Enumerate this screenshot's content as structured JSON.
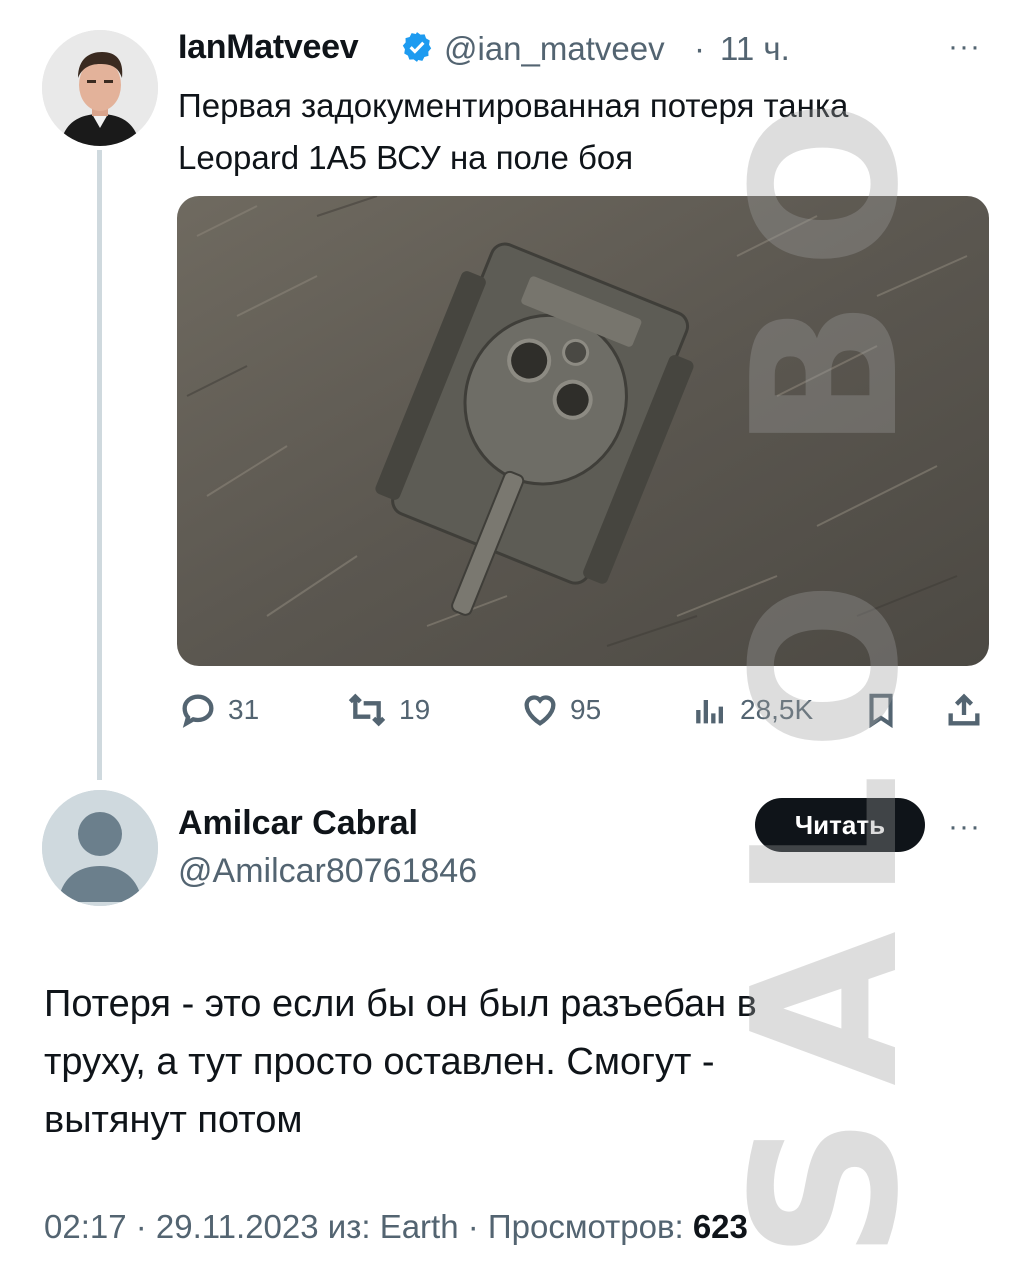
{
  "tweet": {
    "author_name": "IanMatveev",
    "author_handle": "@ian_matveev",
    "separator": "·",
    "time": "11 ч.",
    "more": "···",
    "text": "Первая задокументированная потеря танка\nLeopard 1A5 ВСУ на поле боя",
    "image_alt": "Tank on field",
    "actions": {
      "replies": "31",
      "retweets": "19",
      "likes": "95",
      "views": "28,5K"
    },
    "icons": [
      "verified-icon",
      "reply-icon",
      "retweet-icon",
      "like-icon",
      "views-icon",
      "bookmark-icon",
      "share-icon"
    ]
  },
  "reply": {
    "author_name": "Amilcar Cabral",
    "author_handle": "@Amilcar80761846",
    "follow_label": "Читать",
    "more": "···",
    "text": "Потеря - это если бы он был разъебан в\nтруху, а тут просто оставлен. Смогут -\nвытянут потом",
    "footer_prefix": "02:17 · 29.11.2023 из: Earth · Просмотров: ",
    "footer_views": "623"
  },
  "watermark": "SALO BO",
  "colors": {
    "text": "#0f1419",
    "secondary": "#536471",
    "verified": "#1d9bf0",
    "thread": "#cfd9de"
  }
}
